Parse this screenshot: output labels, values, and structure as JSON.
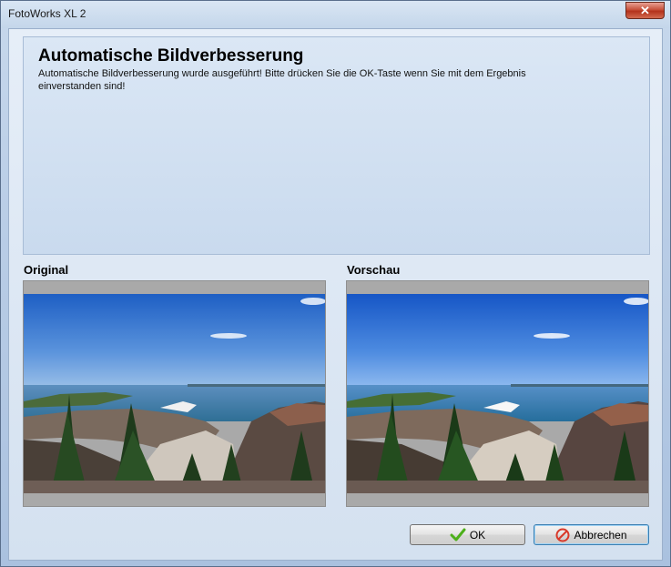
{
  "window": {
    "title": "FotoWorks XL 2",
    "close_label": "✕"
  },
  "header": {
    "title": "Automatische Bildverbesserung",
    "description": "Automatische Bildverbesserung wurde ausgeführt! Bitte drücken Sie die OK-Taste wenn Sie mit dem Ergebnis einverstanden sind!"
  },
  "panes": {
    "original_label": "Original",
    "preview_label": "Vorschau"
  },
  "buttons": {
    "ok_label": "OK",
    "cancel_label": "Abbrechen"
  },
  "icons": {
    "ok": "checkmark-icon",
    "cancel": "cancel-icon"
  },
  "colors": {
    "ok_check": "#4caf1a",
    "cancel_icon": "#d9392a"
  }
}
